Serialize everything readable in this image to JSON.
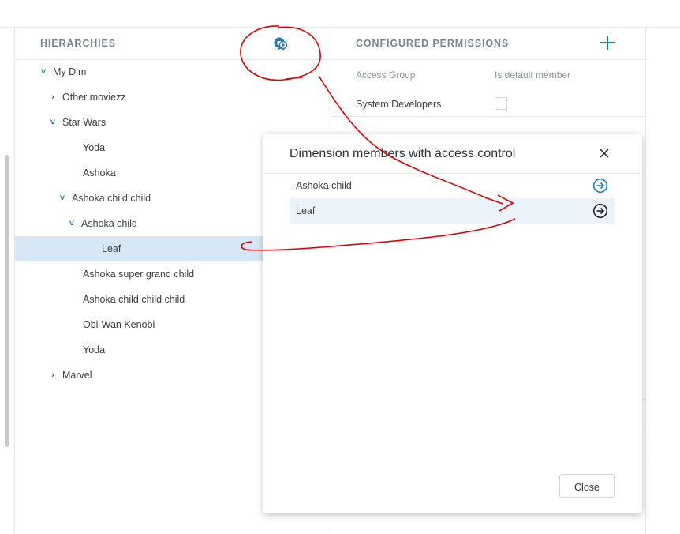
{
  "colors": {
    "accent": "#1f7ab8",
    "selected_row": "#d6e8f5",
    "annotation": "#e00000"
  },
  "hierarchies": {
    "title": "HIERARCHIES",
    "icon": "access-control-icon",
    "tree": [
      {
        "label": "My Dim",
        "toggle": "expanded"
      },
      {
        "label": "Other moviezz",
        "toggle": "collapsed"
      },
      {
        "label": "Star Wars",
        "toggle": "expanded"
      },
      {
        "label": "Yoda",
        "toggle": "none"
      },
      {
        "label": "Ashoka",
        "toggle": "none"
      },
      {
        "label": "Ashoka child child",
        "toggle": "expanded"
      },
      {
        "label": "Ashoka child",
        "toggle": "expanded"
      },
      {
        "label": "Leaf",
        "toggle": "none",
        "selected": true
      },
      {
        "label": "Ashoka super grand child",
        "toggle": "none"
      },
      {
        "label": "Ashoka child child child",
        "toggle": "none"
      },
      {
        "label": "Obi-Wan Kenobi",
        "toggle": "none"
      },
      {
        "label": "Yoda",
        "toggle": "none"
      },
      {
        "label": "Marvel",
        "toggle": "collapsed"
      }
    ]
  },
  "permissions": {
    "title": "CONFIGURED PERMISSIONS",
    "add_icon": "plus-icon",
    "col_access_group": "Access Group",
    "col_default_member": "Is default member",
    "rows": [
      {
        "group": "System.Developers",
        "is_default": false
      }
    ]
  },
  "modal": {
    "title": "Dimension members with access control",
    "close_icon": "close-icon",
    "members": [
      {
        "label": "Ashoka child",
        "icon": "arrow-circle-right-icon",
        "highlighted": false
      },
      {
        "label": "Leaf",
        "icon": "arrow-circle-right-icon",
        "highlighted": true
      }
    ],
    "close_label": "Close"
  }
}
